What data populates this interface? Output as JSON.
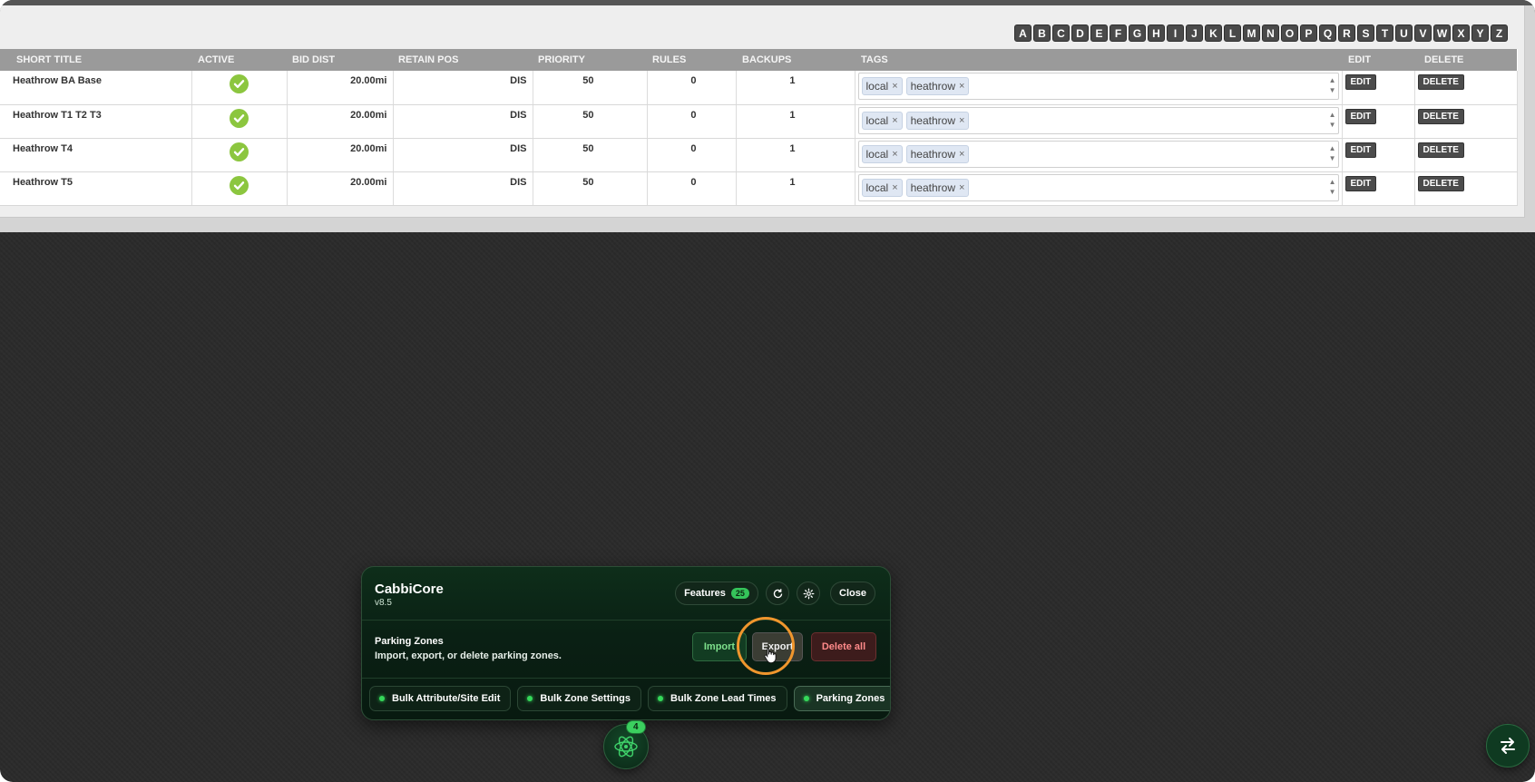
{
  "letters": [
    "A",
    "B",
    "C",
    "D",
    "E",
    "F",
    "G",
    "H",
    "I",
    "J",
    "K",
    "L",
    "M",
    "N",
    "O",
    "P",
    "Q",
    "R",
    "S",
    "T",
    "U",
    "V",
    "W",
    "X",
    "Y",
    "Z"
  ],
  "table": {
    "headers": {
      "short_title": "SHORT TITLE",
      "active": "ACTIVE",
      "bid_dist": "BID DIST",
      "retain_pos": "RETAIN POS",
      "priority": "PRIORITY",
      "rules": "RULES",
      "backups": "BACKUPS",
      "tags": "TAGS",
      "edit": "EDIT",
      "delete": "DELETE"
    },
    "rows": [
      {
        "title": "Heathrow BA Base",
        "active": true,
        "bid_dist": "20.00mi",
        "retain_pos": "DIS",
        "priority": "50",
        "rules": "0",
        "backups": "1",
        "tags": [
          "local",
          "heathrow"
        ],
        "edit": "EDIT",
        "delete": "DELETE"
      },
      {
        "title": "Heathrow T1 T2 T3",
        "active": true,
        "bid_dist": "20.00mi",
        "retain_pos": "DIS",
        "priority": "50",
        "rules": "0",
        "backups": "1",
        "tags": [
          "local",
          "heathrow"
        ],
        "edit": "EDIT",
        "delete": "DELETE"
      },
      {
        "title": "Heathrow T4",
        "active": true,
        "bid_dist": "20.00mi",
        "retain_pos": "DIS",
        "priority": "50",
        "rules": "0",
        "backups": "1",
        "tags": [
          "local",
          "heathrow"
        ],
        "edit": "EDIT",
        "delete": "DELETE"
      },
      {
        "title": "Heathrow T5",
        "active": true,
        "bid_dist": "20.00mi",
        "retain_pos": "DIS",
        "priority": "50",
        "rules": "0",
        "backups": "1",
        "tags": [
          "local",
          "heathrow"
        ],
        "edit": "EDIT",
        "delete": "DELETE"
      }
    ]
  },
  "panel": {
    "title": "CabbiCore",
    "version": "v8.5",
    "features_label": "Features",
    "features_count": "25",
    "close_label": "Close",
    "section_title": "Parking Zones",
    "section_desc": "Import, export, or delete parking zones.",
    "import_label": "Import",
    "export_label": "Export",
    "delete_all_label": "Delete all",
    "tabs": [
      {
        "label": "Bulk Attribute/Site Edit",
        "active": false
      },
      {
        "label": "Bulk Zone Settings",
        "active": false
      },
      {
        "label": "Bulk Zone Lead Times",
        "active": false
      },
      {
        "label": "Parking Zones",
        "active": true
      }
    ]
  },
  "launcher_badge": "4",
  "colors": {
    "accent_green": "#35c45a",
    "highlight_ring": "#f0962d",
    "delete_red": "#ff8a8a"
  }
}
